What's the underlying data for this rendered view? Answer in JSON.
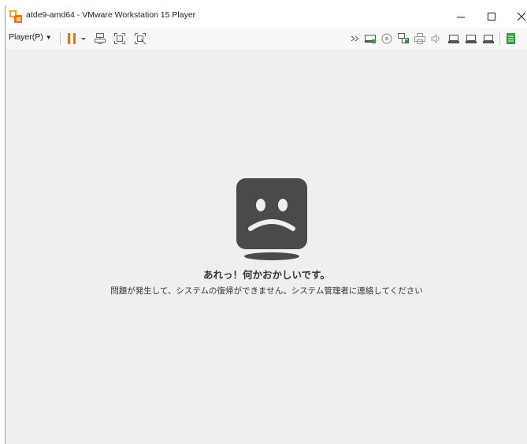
{
  "window": {
    "title": "atde9-amd64 - VMware Workstation 15 Player",
    "controls": [
      "minimize-icon",
      "maximize-icon",
      "close-icon"
    ]
  },
  "toolbar": {
    "player_menu_label": "Player(P)",
    "left_icons": [
      "pause-icon",
      "dropdown-arrow-icon",
      "send-ctrl-alt-del-icon",
      "fit-guest-icon",
      "unity-icon"
    ],
    "right_icons": [
      "overflow-chevron-icon",
      "hard-disk-icon",
      "cd-dvd-icon",
      "network-adapter-icon",
      "printer-icon",
      "sound-icon",
      "usb-device-icon",
      "usb-device-icon",
      "usb-device-icon",
      "message-log-icon"
    ]
  },
  "error": {
    "title": "あれっ！何かおかしいです。",
    "message": "問題が発生して、システムの復帰ができません。システム管理者に連絡してください"
  },
  "colors": {
    "accent_pause": "#e8731a",
    "face": "#4a4a4a",
    "screen_bg": "#efefef"
  }
}
